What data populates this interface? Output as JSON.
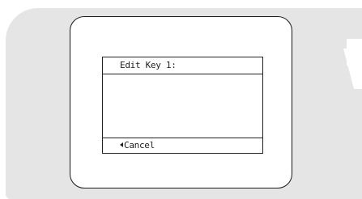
{
  "dialog": {
    "title": "Edit Key 1:",
    "body_text": "",
    "cancel_label": "Cancel",
    "cancel_icon": "left-triangle-icon"
  },
  "colors": {
    "bezel": "#e5e5e5",
    "screen_background": "#ffffff",
    "line": "#222222"
  }
}
